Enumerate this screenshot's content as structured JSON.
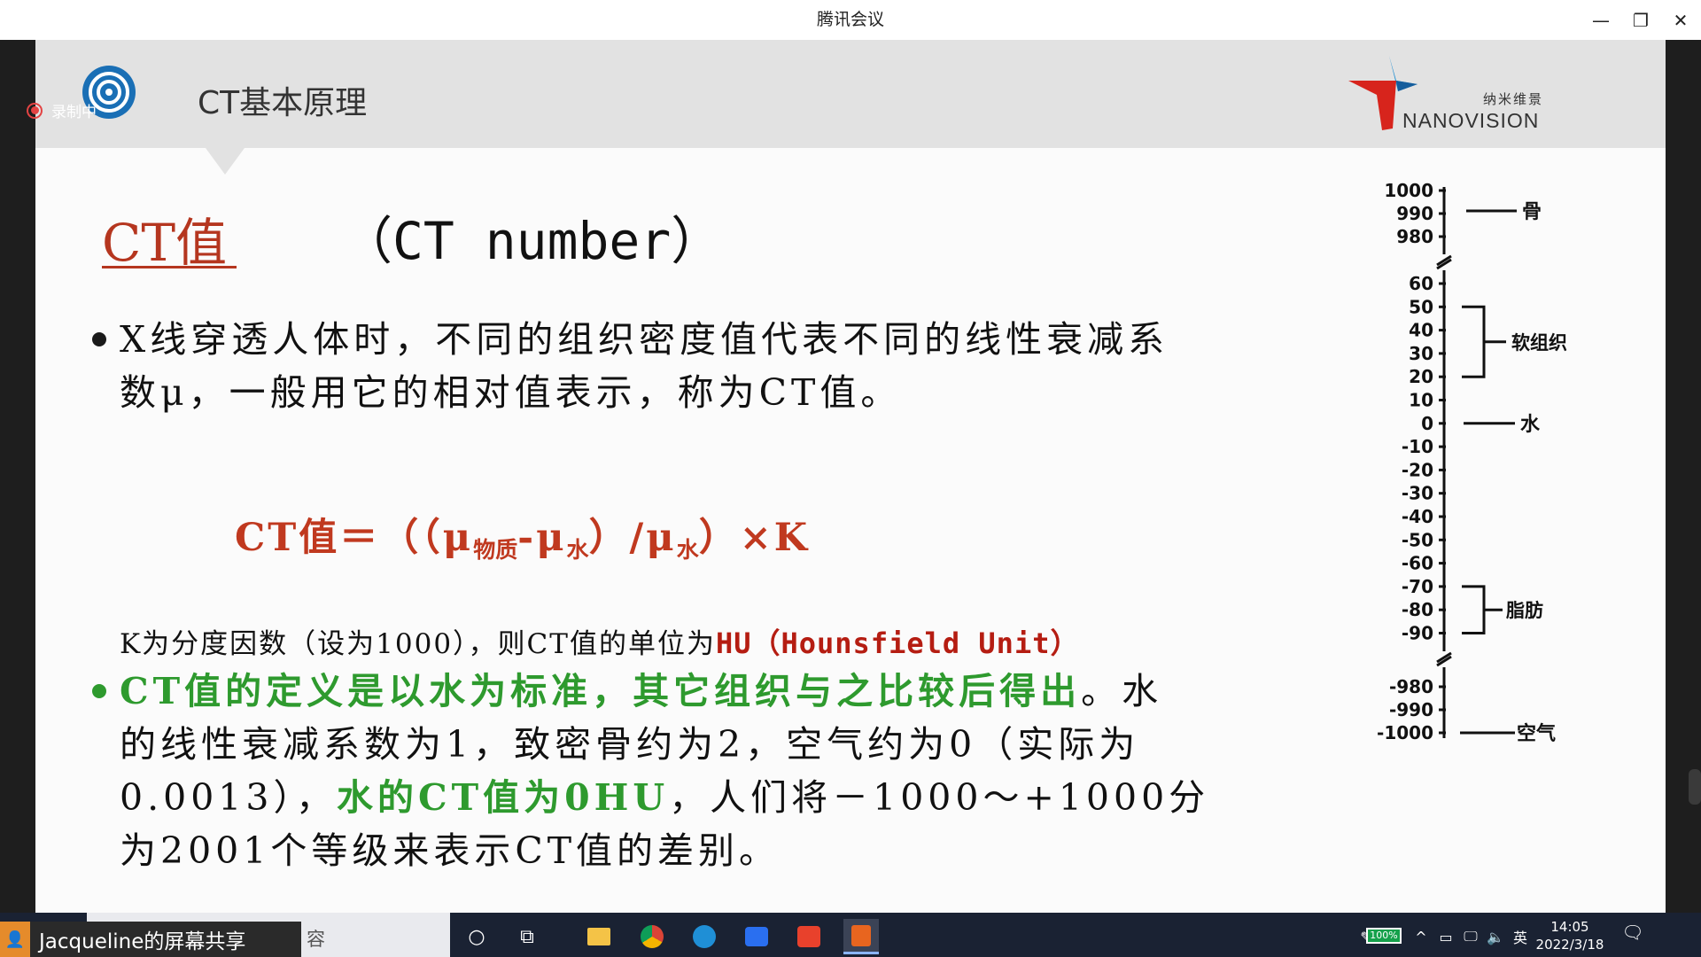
{
  "window": {
    "title": "腾讯会议",
    "minimize_icon": "—",
    "restore_icon": "❐",
    "close_icon": "✕"
  },
  "recording": {
    "label": "录制中"
  },
  "slide": {
    "heading": "CT基本原理",
    "brand_cn": "纳米维景",
    "brand_en": "NANOVISION",
    "title_cn": "CT值",
    "title_en": "（CT number）",
    "bullet1_line1": "X线穿透人体时，不同的组织密度值代表不同的线性衰减系",
    "bullet1_line2": "数μ，一般用它的相对值表示，称为CT值。",
    "formula_lead": "CT值＝（（μ",
    "formula_sub1": "物质",
    "formula_mid": "-μ",
    "formula_sub2": "水",
    "formula_mid2": "）/μ",
    "formula_sub3": "水",
    "formula_tail": "）×K",
    "k_text": "K为分度因数（设为1000），则CT值的单位为",
    "k_unit": "HU（Hounsfield Unit）",
    "bullet2_green1": "CT值的定义是以水为标准，其它组织与之比较后得出",
    "bullet2_line1_tail": "。水",
    "bullet2_line2": "的线性衰减系数为1，致密骨约为2，空气约为0（实际为",
    "bullet2_line3_head": "0.0013），",
    "bullet2_green2": "水的CT值为0HU",
    "bullet2_line3_tail": "，人们将－1000～+1000分",
    "bullet2_line4": "为2001个等级来表示CT值的差别。",
    "bullet_color": "#1a1a1a",
    "bullet2_color": "#2e9a2e",
    "accent_color": "#b5361f"
  },
  "scale": {
    "top_ticks": [
      "1000",
      "990",
      "980"
    ],
    "mid_ticks": [
      "60",
      "50",
      "40",
      "30",
      "20",
      "10",
      "0",
      "-10",
      "-20",
      "-30",
      "-40",
      "-50",
      "-60",
      "-70",
      "-80",
      "-90"
    ],
    "bottom_ticks": [
      "-980",
      "-990",
      "-1000"
    ],
    "labels": {
      "bone": "骨",
      "soft_tissue": "软组织",
      "water": "水",
      "fat": "脂肪",
      "air": "空气"
    }
  },
  "taskbar": {
    "share_label": "Jacqueline的屏幕共享",
    "search_text": "容",
    "battery": "100%",
    "ime": "英",
    "time": "14:05",
    "date": "2022/3/18"
  }
}
